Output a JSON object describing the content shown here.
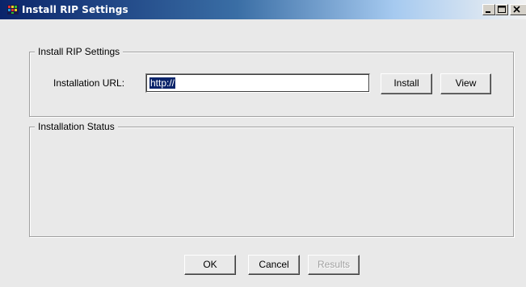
{
  "window": {
    "title": "Install RIP Settings",
    "title_bar_gradient": [
      "#0a246a",
      "#3a6ea5",
      "#a6caf0"
    ]
  },
  "window_controls": {
    "minimize": "minimize-icon",
    "maximize": "maximize-icon",
    "close": "close-icon"
  },
  "install_group": {
    "legend": "Install RIP Settings",
    "url_label": "Installation URL:",
    "url_value": "http://",
    "install_label": "Install",
    "view_label": "View"
  },
  "status_group": {
    "legend": "Installation Status"
  },
  "footer": {
    "ok_label": "OK",
    "cancel_label": "Cancel",
    "results_label": "Results",
    "results_enabled": false
  },
  "colors": {
    "dialog_bg": "#e9e9e9",
    "selection": "#0a246a",
    "disabled_text": "#a0a0a0"
  }
}
